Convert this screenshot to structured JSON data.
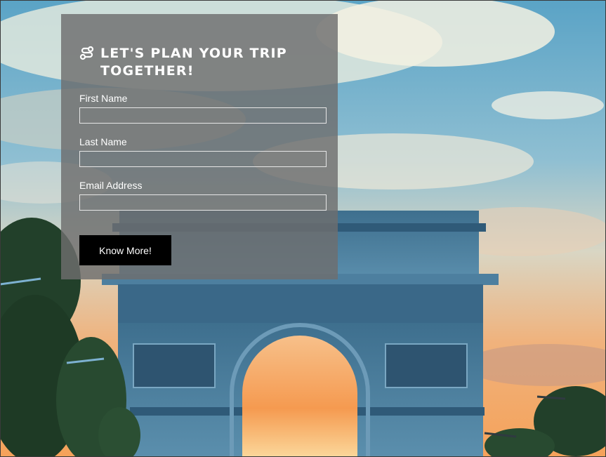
{
  "form": {
    "heading": "LET'S PLAN YOUR TRIP TOGETHER!",
    "heading_icon": "route-icon",
    "fields": [
      {
        "label": "First Name",
        "value": "",
        "placeholder": ""
      },
      {
        "label": "Last Name",
        "value": "",
        "placeholder": ""
      },
      {
        "label": "Email Address",
        "value": "",
        "placeholder": ""
      }
    ],
    "submit_label": "Know More!"
  },
  "background": {
    "subject": "arc-de-triomphe-sunset-photo"
  },
  "colors": {
    "panel_overlay": "#6e6e6e",
    "button_bg": "#000000",
    "text": "#ffffff",
    "sky_blue": "#4a98bf",
    "sunset_orange": "#f2a35e"
  }
}
